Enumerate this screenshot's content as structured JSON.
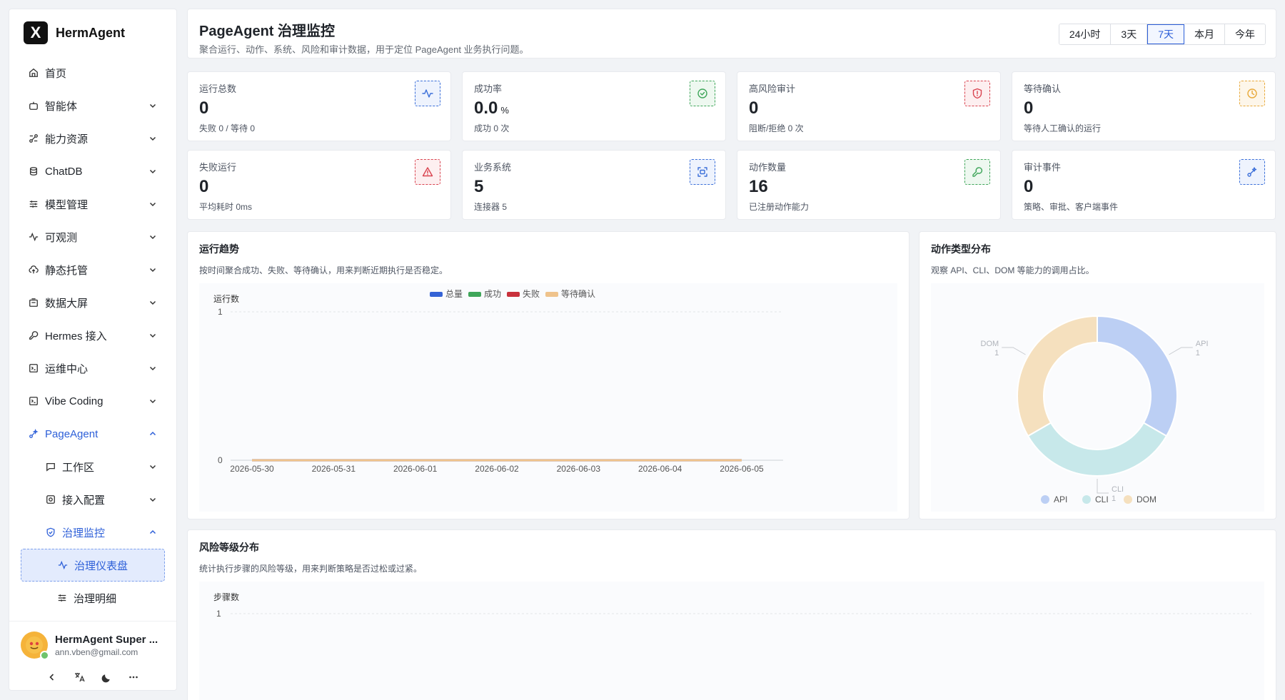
{
  "app": {
    "name": "HermAgent",
    "logo_letter": "X"
  },
  "sidebar": {
    "items": [
      {
        "label": "首页",
        "icon": "home-icon"
      },
      {
        "label": "智能体",
        "icon": "bot-icon"
      },
      {
        "label": "能力资源",
        "icon": "resource-icon"
      },
      {
        "label": "ChatDB",
        "icon": "database-icon"
      },
      {
        "label": "模型管理",
        "icon": "sliders-icon"
      },
      {
        "label": "可观测",
        "icon": "activity-icon"
      },
      {
        "label": "静态托管",
        "icon": "cloud-icon"
      },
      {
        "label": "数据大屏",
        "icon": "screen-icon"
      },
      {
        "label": "Hermes 接入",
        "icon": "wrench-icon"
      },
      {
        "label": "运维中心",
        "icon": "terminal-icon"
      },
      {
        "label": "Vibe Coding",
        "icon": "terminal-icon"
      },
      {
        "label": "PageAgent",
        "icon": "sparkle-icon"
      }
    ],
    "pageagent_children": [
      {
        "label": "工作区",
        "icon": "chat-icon"
      },
      {
        "label": "接入配置",
        "icon": "scan-icon"
      },
      {
        "label": "治理监控",
        "icon": "shield-icon"
      }
    ],
    "governance_children": [
      {
        "label": "治理仪表盘",
        "icon": "activity-icon"
      },
      {
        "label": "治理明细",
        "icon": "sliders-icon"
      }
    ]
  },
  "user": {
    "name": "HermAgent Super ...",
    "email": "ann.vben@gmail.com"
  },
  "header": {
    "title": "PageAgent 治理监控",
    "desc": "聚合运行、动作、系统、风险和审计数据，用于定位 PageAgent 业务执行问题。",
    "ranges": [
      "24小时",
      "3天",
      "7天",
      "本月",
      "今年"
    ],
    "active_range": "7天"
  },
  "stats": [
    {
      "label": "运行总数",
      "value": "0",
      "unit": "",
      "sub": "失败 0 / 等待 0",
      "icon": "activity-icon",
      "color": "#3b6fd9"
    },
    {
      "label": "成功率",
      "value": "0.0",
      "unit": "%",
      "sub": "成功 0 次",
      "icon": "check-circle-icon",
      "color": "#3fa65a"
    },
    {
      "label": "高风险审计",
      "value": "0",
      "unit": "",
      "sub": "阻断/拒绝 0 次",
      "icon": "shield-alert-icon",
      "color": "#d9434f"
    },
    {
      "label": "等待确认",
      "value": "0",
      "unit": "",
      "sub": "等待人工确认的运行",
      "icon": "clock-icon",
      "color": "#e8a93a"
    },
    {
      "label": "失败运行",
      "value": "0",
      "unit": "",
      "sub": "平均耗时 0ms",
      "icon": "warning-icon",
      "color": "#d9434f"
    },
    {
      "label": "业务系统",
      "value": "5",
      "unit": "",
      "sub": "连接器 5",
      "icon": "scan-icon",
      "color": "#3b6fd9"
    },
    {
      "label": "动作数量",
      "value": "16",
      "unit": "",
      "sub": "已注册动作能力",
      "icon": "wrench-icon",
      "color": "#3fa65a"
    },
    {
      "label": "审计事件",
      "value": "0",
      "unit": "",
      "sub": "策略、审批、客户端事件",
      "icon": "sparkle-icon",
      "color": "#3b6fd9"
    }
  ],
  "trend_panel": {
    "title": "运行趋势",
    "desc": "按时间聚合成功、失败、等待确认，用来判断近期执行是否稳定。"
  },
  "pie_panel": {
    "title": "动作类型分布",
    "desc": "观察 API、CLI、DOM 等能力的调用占比。"
  },
  "risk_panel": {
    "title": "风险等级分布",
    "desc": "统计执行步骤的风险等级，用来判断策略是否过松或过紧。"
  },
  "chart_data": [
    {
      "type": "line",
      "ylabel": "运行数",
      "ylim": [
        0,
        1
      ],
      "y_ticks": [
        "0",
        "1"
      ],
      "x": [
        "2026-05-30",
        "2026-05-31",
        "2026-06-01",
        "2026-06-02",
        "2026-06-03",
        "2026-06-04",
        "2026-06-05"
      ],
      "series": [
        {
          "name": "总量",
          "color": "#3563d6",
          "values": [
            0,
            0,
            0,
            0,
            0,
            0,
            0
          ]
        },
        {
          "name": "成功",
          "color": "#3fa65a",
          "values": [
            0,
            0,
            0,
            0,
            0,
            0,
            0
          ]
        },
        {
          "name": "失败",
          "color": "#c8323c",
          "values": [
            0,
            0,
            0,
            0,
            0,
            0,
            0
          ]
        },
        {
          "name": "等待确认",
          "color": "#efc38c",
          "values": [
            0,
            0,
            0,
            0,
            0,
            0,
            0
          ]
        }
      ],
      "legend": "top-center"
    },
    {
      "type": "pie",
      "slices": [
        {
          "name": "API",
          "value": 1,
          "color": "#bccff4"
        },
        {
          "name": "CLI",
          "value": 1,
          "color": "#c7e8ea"
        },
        {
          "name": "DOM",
          "value": 1,
          "color": "#f5e0be"
        }
      ],
      "legend": "bottom-center"
    },
    {
      "type": "bar",
      "ylabel": "步骤数",
      "ylim": [
        0,
        1
      ],
      "y_ticks": [
        "1"
      ]
    }
  ]
}
